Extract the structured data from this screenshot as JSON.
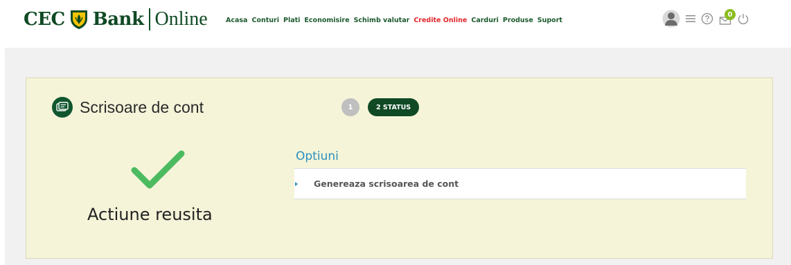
{
  "brand": {
    "cec": "CEC",
    "bank": "Bank",
    "online": "Online"
  },
  "nav": [
    {
      "label": "Acasa",
      "active": false
    },
    {
      "label": "Conturi",
      "active": false
    },
    {
      "label": "Plati",
      "active": false
    },
    {
      "label": "Economisire",
      "active": false
    },
    {
      "label": "Schimb valutar",
      "active": false
    },
    {
      "label": "Credite Online",
      "active": true
    },
    {
      "label": "Carduri",
      "active": false
    },
    {
      "label": "Produse",
      "active": false
    },
    {
      "label": "Suport",
      "active": false
    }
  ],
  "header_icons": {
    "user": "user-avatar-icon",
    "menu": "hamburger-menu-icon",
    "help": "help-circle-icon",
    "mail": "mail-icon",
    "mail_badge": "0",
    "power": "power-icon"
  },
  "card": {
    "title": "Scrisoare de cont",
    "step1": "1",
    "step2": "2 STATUS",
    "success": "Actiune reusita",
    "options_title": "Optiuni",
    "option_1": "Genereaza scrisoarea de cont"
  },
  "colors": {
    "brand_green": "#0f4a24",
    "accent_red": "#e3262c",
    "check_green": "#4cbb5f",
    "link_blue": "#2a8fbd",
    "card_bg": "#f5f4d9"
  }
}
